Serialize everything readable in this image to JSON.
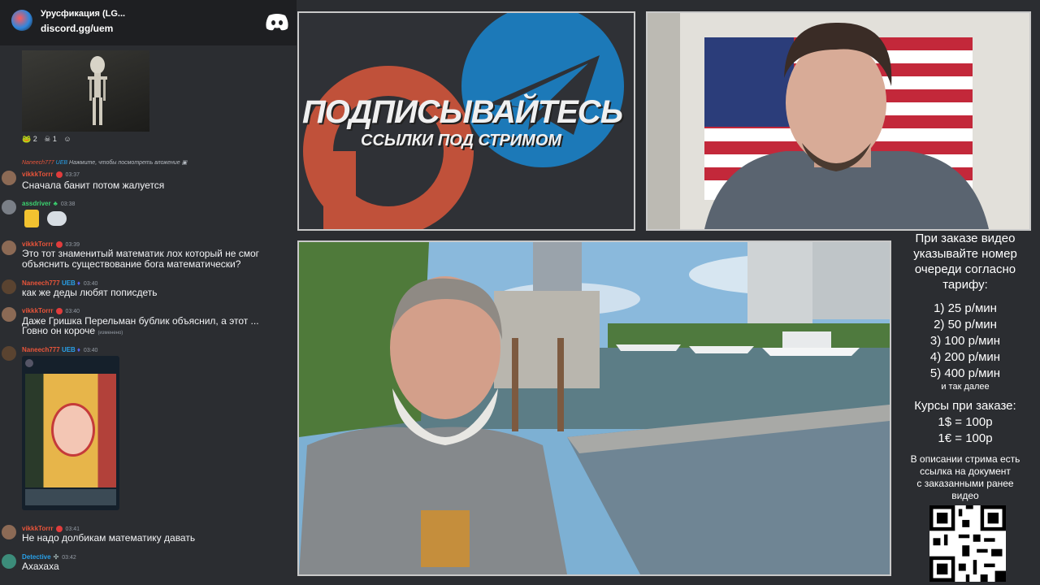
{
  "header": {
    "server_name": "Урусфикация (LG...",
    "server_link": "discord.gg/uem",
    "discord_icon": "discord-logo-icon"
  },
  "reactions": [
    {
      "icon": "frog-emoji",
      "count": "2"
    },
    {
      "icon": "skull-emoji",
      "count": "1"
    },
    {
      "icon": "add-reaction-icon",
      "count": ""
    }
  ],
  "reply_hint": {
    "name": "Naneech777",
    "tag": "UEB",
    "text": "Нажмите, чтобы посмотреть вложение"
  },
  "messages": [
    {
      "user": "vikkkTorrr",
      "time": "03:37",
      "text": "Сначала банит потом жалуется"
    },
    {
      "user": "assdriver",
      "time": "03:38",
      "text": ""
    },
    {
      "user": "vikkkTorrr",
      "time": "03:39",
      "text": "Это тот знаменитый математик лох который не смог",
      "text2": "объяснить существование бога математически?"
    },
    {
      "user": "Naneech777",
      "tag": "UEB",
      "time": "03:40",
      "text": "как же деды любят пописдеть"
    },
    {
      "user": "vikkkTorrr",
      "time": "03:40",
      "text": "Даже Гришка Перельман бублик объяснил, а этот ...",
      "text2": "Говно он короче",
      "edited": "(изменено)"
    },
    {
      "user": "Naneech777",
      "tag": "UEB",
      "time": "03:40",
      "text": ""
    },
    {
      "user": "vikkkTorrr",
      "time": "03:41",
      "text": "Не надо долбикам математику давать"
    },
    {
      "user": "Detective",
      "time": "03:42",
      "text": "Ахахаха"
    }
  ],
  "promo": {
    "title": "ПОДПИСЫВАЙТЕСЬ",
    "subtitle": "ССЫЛКИ ПОД СТРИМОМ",
    "left_logo": "patreon-like-logo-icon",
    "right_logo": "telegram-logo-icon"
  },
  "info": {
    "heading": [
      "При заказе видео",
      "указывайте номер",
      "очереди согласно",
      "тарифу:"
    ],
    "tariffs": [
      "1) 25 р/мин",
      "2) 50 р/мин",
      "3) 100 р/мин",
      "4) 200 р/мин",
      "5) 400 р/мин"
    ],
    "etc": "и так далее",
    "rates_title": "Курсы при заказе:",
    "rates": [
      "1$ = 100р",
      "1€ = 100р"
    ],
    "note": [
      "В описании стрима есть",
      "ссылка на документ",
      "с заказанными ранее",
      "видео"
    ],
    "qr_icon": "qr-code-icon"
  }
}
